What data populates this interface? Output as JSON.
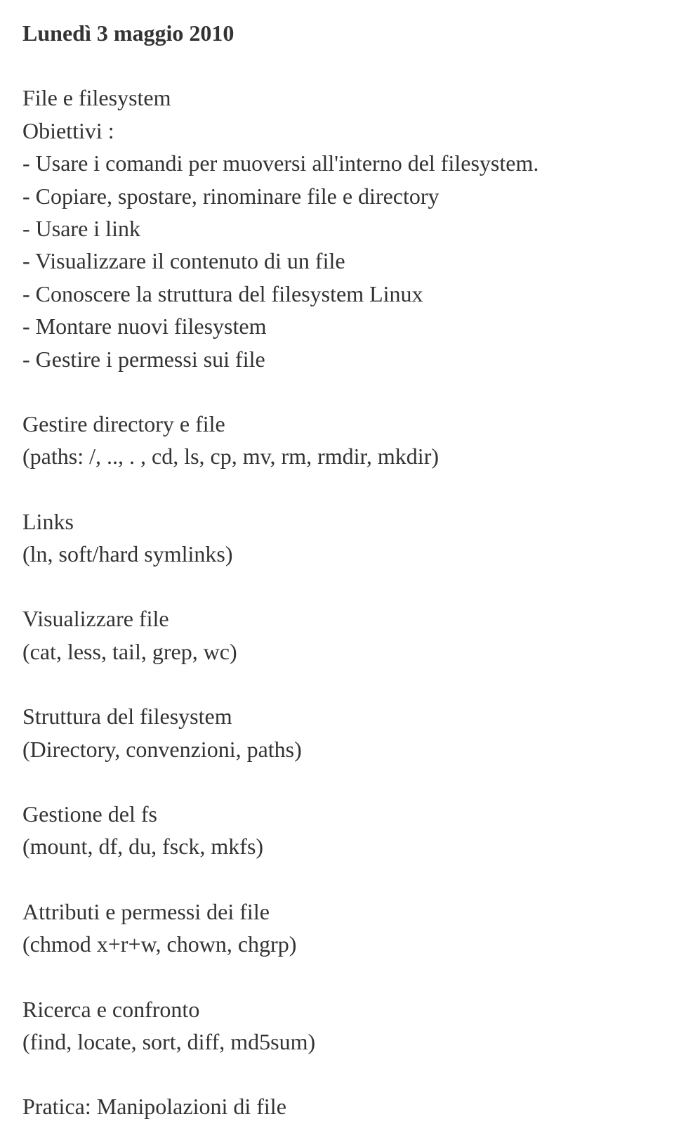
{
  "title": "Lunedì 3 maggio 2010",
  "intro": {
    "line1": "File e filesystem",
    "line2": "Obiettivi :",
    "b1": "- Usare i comandi per muoversi all'interno del filesystem.",
    "b2": "- Copiare, spostare, rinominare file e directory",
    "b3": "- Usare i link",
    "b4": "- Visualizzare il contenuto di un file",
    "b5": "- Conoscere la struttura del filesystem Linux",
    "b6": "- Montare nuovi filesystem",
    "b7": "- Gestire i permessi sui file"
  },
  "s1": {
    "h": "Gestire directory e file",
    "d": "(paths: /, .., . , cd, ls, cp, mv, rm, rmdir, mkdir)"
  },
  "s2": {
    "h": "Links",
    "d": "(ln, soft/hard symlinks)"
  },
  "s3": {
    "h": "Visualizzare file",
    "d": "(cat, less, tail, grep, wc)"
  },
  "s4": {
    "h": "Struttura del filesystem",
    "d": "(Directory, convenzioni, paths)"
  },
  "s5": {
    "h": "Gestione del fs",
    "d": "(mount, df, du, fsck, mkfs)"
  },
  "s6": {
    "h": "Attributi e permessi dei file",
    "d": "(chmod x+r+w, chown, chgrp)"
  },
  "s7": {
    "h": "Ricerca e confronto",
    "d": "(find, locate, sort, diff, md5sum)"
  },
  "s8": {
    "h": "Pratica: Manipolazioni di file"
  }
}
